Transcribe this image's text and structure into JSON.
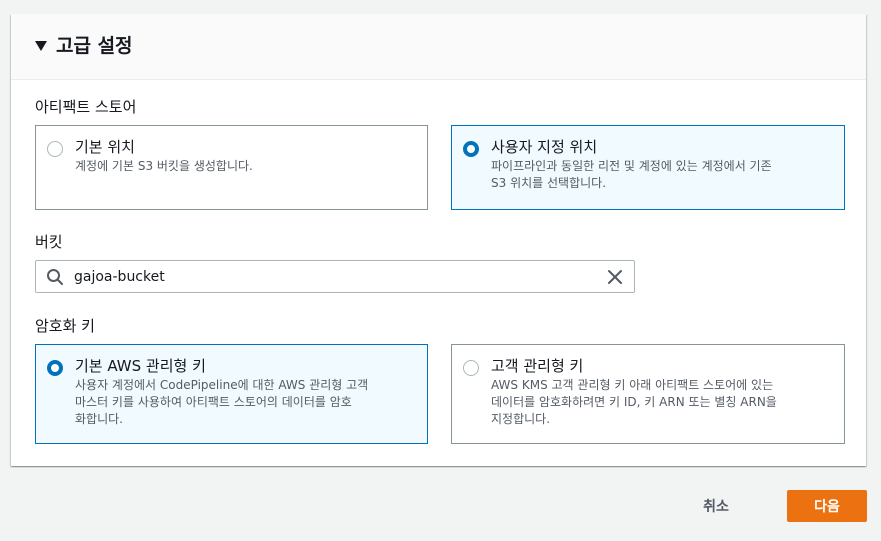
{
  "section": {
    "title": "고급 설정"
  },
  "artifact_store": {
    "label": "아티팩트 스토어",
    "options": [
      {
        "title": "기본 위치",
        "description": "계정에 기본 S3 버킷을 생성합니다.",
        "selected": false
      },
      {
        "title": "사용자 지정 위치",
        "description": "파이프라인과 동일한 리전 및 계정에 있는 계정에서 기존\nS3 위치를 선택합니다.",
        "selected": true
      }
    ]
  },
  "bucket": {
    "label": "버킷",
    "value": "gajoa-bucket"
  },
  "encryption_key": {
    "label": "암호화 키",
    "options": [
      {
        "title": "기본 AWS 관리형 키",
        "description": "사용자 계정에서 CodePipeline에 대한 AWS 관리형 고객\n마스터 키를 사용하여 아티팩트 스토어의 데이터를 암호\n화합니다.",
        "selected": true
      },
      {
        "title": "고객 관리형 키",
        "description": "AWS KMS 고객 관리형 키 아래 아티팩트 스토어에 있는\n데이터를 암호화하려면 키 ID, 키 ARN 또는 별칭 ARN을\n지정합니다.",
        "selected": false
      }
    ]
  },
  "actions": {
    "cancel_label": "취소",
    "next_label": "다음"
  },
  "colors": {
    "accent": "#0073bb",
    "primary_button": "#ec7211",
    "selected_tile_bg": "#f1faff"
  }
}
